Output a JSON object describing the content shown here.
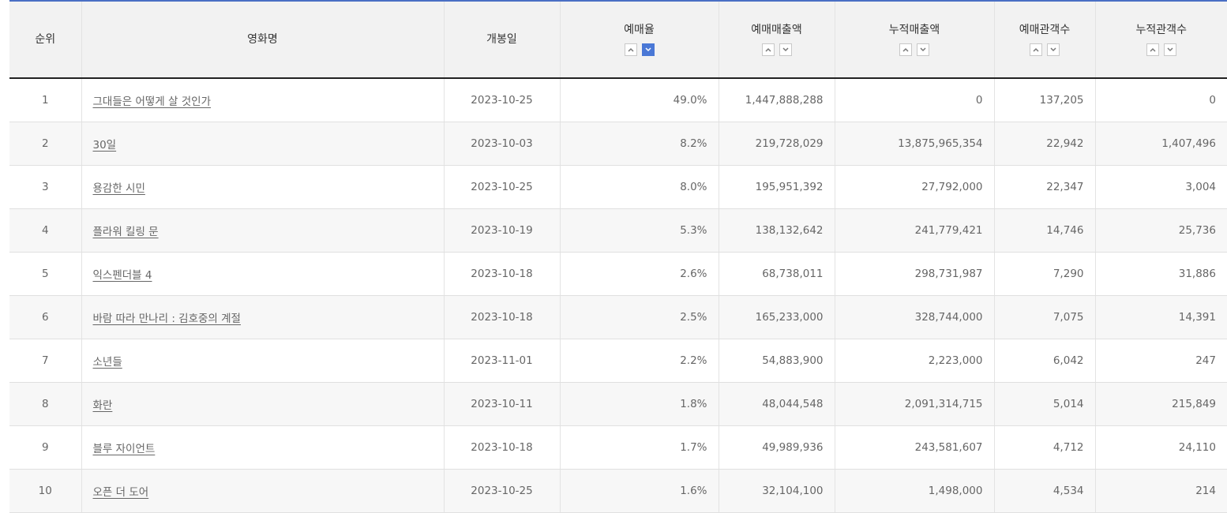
{
  "colors": {
    "header_top_border": "#4a6fc4",
    "active_sort": "#4a78d6",
    "header_bg": "#f2f2f2",
    "zebra_row": "#f7f7f7"
  },
  "table": {
    "headers": {
      "rank": "순위",
      "title": "영화명",
      "release_date": "개봉일",
      "reservation_rate": "예매율",
      "reservation_sales": "예매매출액",
      "cumulative_sales": "누적매출액",
      "reservation_audience": "예매관객수",
      "cumulative_audience": "누적관객수"
    },
    "sort_icons": {
      "up": "chevron-up-icon",
      "down": "chevron-down-icon",
      "active": "예매율 descending"
    },
    "rows": [
      {
        "rank": "1",
        "title": "그대들은 어떻게 살 것인가",
        "release_date": "2023-10-25",
        "reservation_rate": "49.0%",
        "reservation_sales": "1,447,888,288",
        "cumulative_sales": "0",
        "reservation_audience": "137,205",
        "cumulative_audience": "0"
      },
      {
        "rank": "2",
        "title": "30일",
        "release_date": "2023-10-03",
        "reservation_rate": "8.2%",
        "reservation_sales": "219,728,029",
        "cumulative_sales": "13,875,965,354",
        "reservation_audience": "22,942",
        "cumulative_audience": "1,407,496"
      },
      {
        "rank": "3",
        "title": "용감한 시민",
        "release_date": "2023-10-25",
        "reservation_rate": "8.0%",
        "reservation_sales": "195,951,392",
        "cumulative_sales": "27,792,000",
        "reservation_audience": "22,347",
        "cumulative_audience": "3,004"
      },
      {
        "rank": "4",
        "title": "플라워 킬링 문",
        "release_date": "2023-10-19",
        "reservation_rate": "5.3%",
        "reservation_sales": "138,132,642",
        "cumulative_sales": "241,779,421",
        "reservation_audience": "14,746",
        "cumulative_audience": "25,736"
      },
      {
        "rank": "5",
        "title": "익스펜더블 4",
        "release_date": "2023-10-18",
        "reservation_rate": "2.6%",
        "reservation_sales": "68,738,011",
        "cumulative_sales": "298,731,987",
        "reservation_audience": "7,290",
        "cumulative_audience": "31,886"
      },
      {
        "rank": "6",
        "title": "바람 따라 만나리 : 김호중의 계절",
        "release_date": "2023-10-18",
        "reservation_rate": "2.5%",
        "reservation_sales": "165,233,000",
        "cumulative_sales": "328,744,000",
        "reservation_audience": "7,075",
        "cumulative_audience": "14,391"
      },
      {
        "rank": "7",
        "title": "소년들",
        "release_date": "2023-11-01",
        "reservation_rate": "2.2%",
        "reservation_sales": "54,883,900",
        "cumulative_sales": "2,223,000",
        "reservation_audience": "6,042",
        "cumulative_audience": "247"
      },
      {
        "rank": "8",
        "title": "화란",
        "release_date": "2023-10-11",
        "reservation_rate": "1.8%",
        "reservation_sales": "48,044,548",
        "cumulative_sales": "2,091,314,715",
        "reservation_audience": "5,014",
        "cumulative_audience": "215,849"
      },
      {
        "rank": "9",
        "title": "블루 자이언트",
        "release_date": "2023-10-18",
        "reservation_rate": "1.7%",
        "reservation_sales": "49,989,936",
        "cumulative_sales": "243,581,607",
        "reservation_audience": "4,712",
        "cumulative_audience": "24,110"
      },
      {
        "rank": "10",
        "title": "오픈 더 도어",
        "release_date": "2023-10-25",
        "reservation_rate": "1.6%",
        "reservation_sales": "32,104,100",
        "cumulative_sales": "1,498,000",
        "reservation_audience": "4,534",
        "cumulative_audience": "214"
      }
    ]
  }
}
